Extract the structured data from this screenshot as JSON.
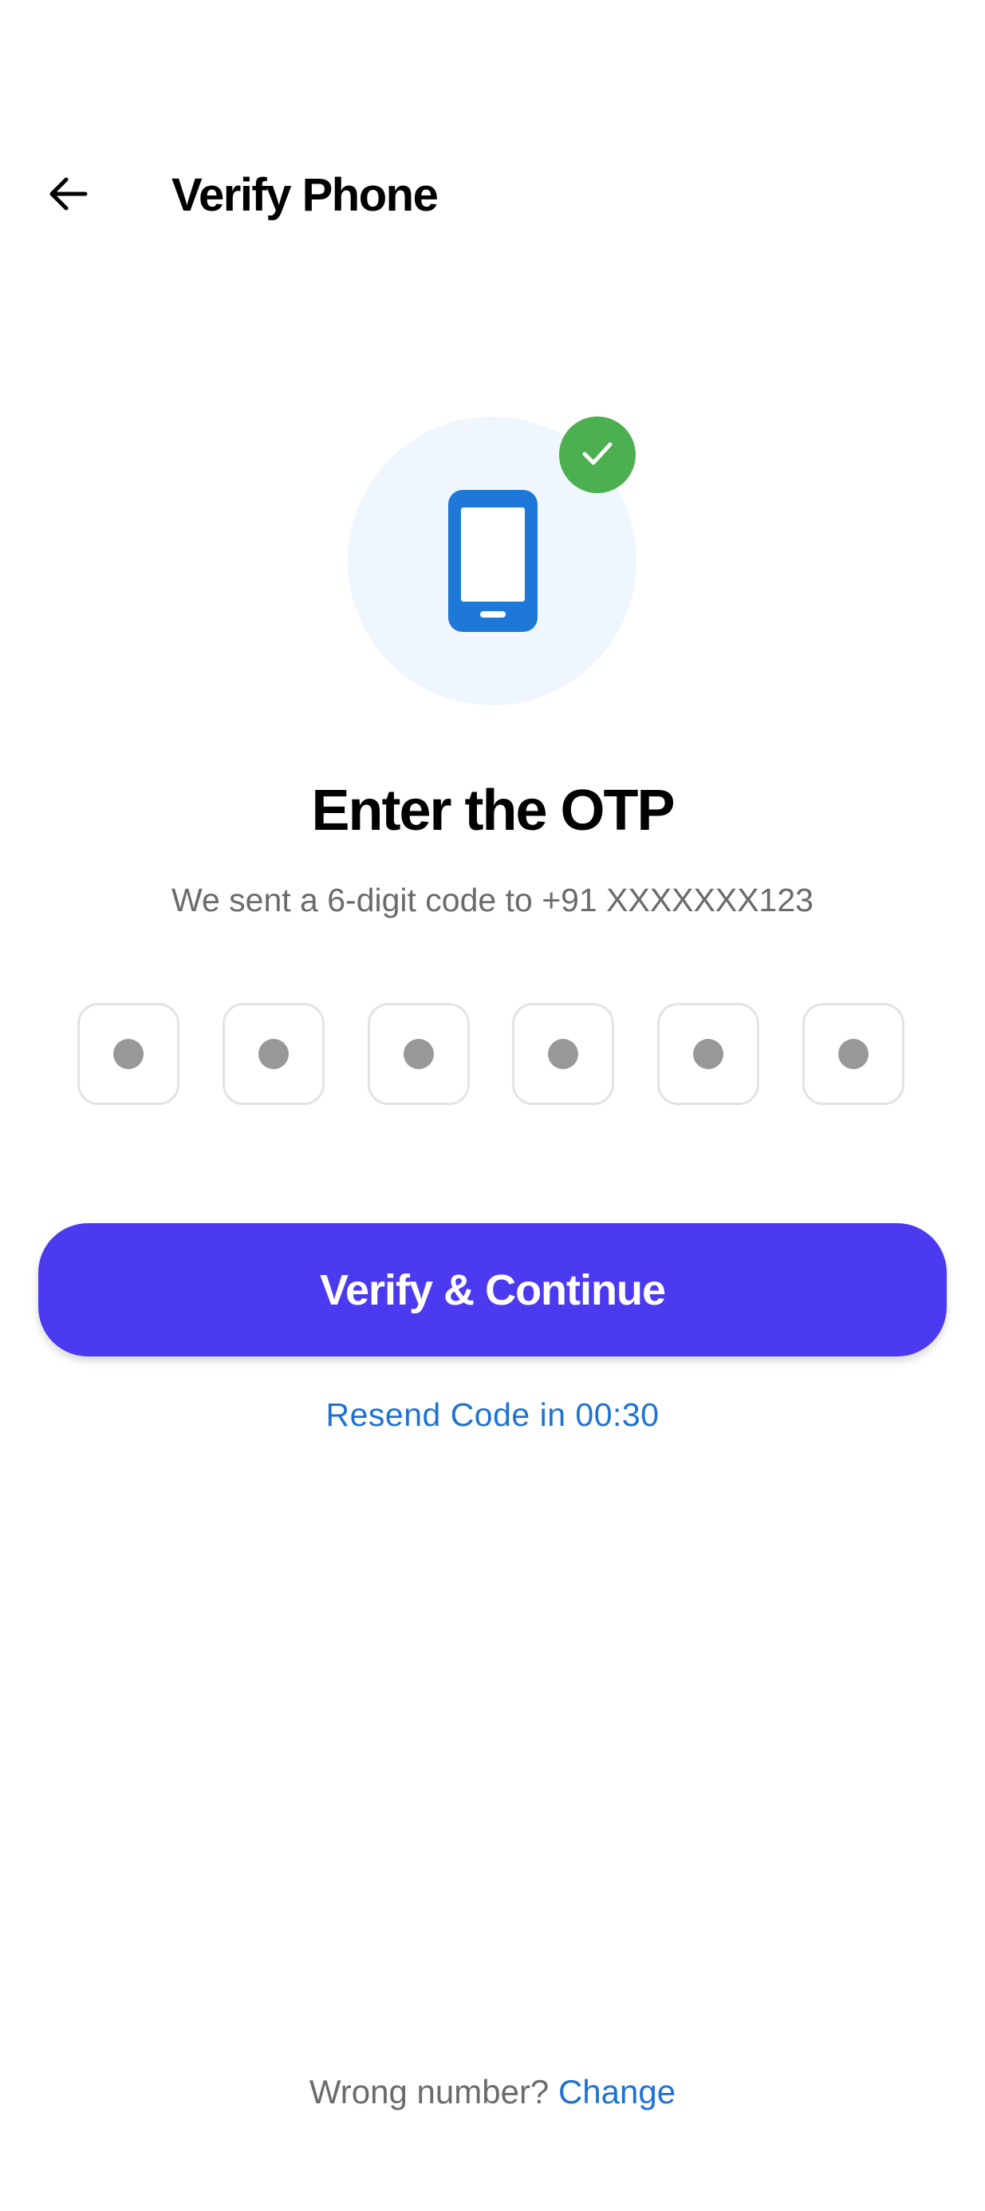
{
  "header": {
    "back_icon": "arrow-left-icon",
    "title": "Verify Phone"
  },
  "illustration": {
    "icon": "smartphone-icon",
    "badge_icon": "check-icon",
    "colors": {
      "circle_bg": "#f0f6fe",
      "phone": "#1e78d8",
      "badge": "#4caf50"
    }
  },
  "main": {
    "heading": "Enter the OTP",
    "subtext": "We sent a 6-digit code to +91 XXXXXXX123",
    "otp_digits": [
      "",
      "",
      "",
      "",
      "",
      ""
    ],
    "verify_label": "Verify & Continue",
    "resend_label": "Resend Code in 00:30"
  },
  "footer": {
    "prompt": "Wrong number?",
    "change_label": "Change"
  },
  "colors": {
    "primary_button": "#4b3aef",
    "link": "#1e73d2",
    "muted_text": "#6b6b6b"
  }
}
